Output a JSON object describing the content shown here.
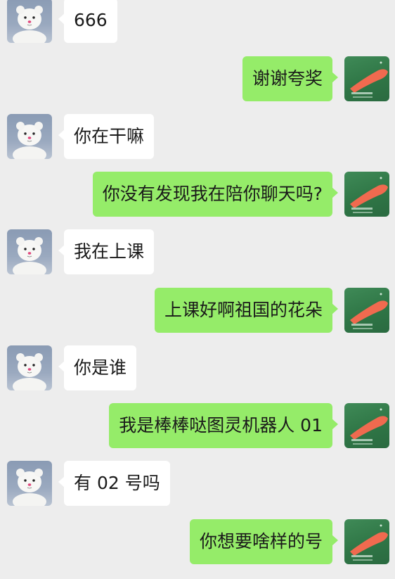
{
  "conversation": {
    "messages": [
      {
        "side": "left",
        "text": "666",
        "avatar": "bear-avatar"
      },
      {
        "side": "right",
        "text": "谢谢夸奖",
        "avatar": "green-cartoon-avatar"
      },
      {
        "side": "left",
        "text": "你在干嘛",
        "avatar": "bear-avatar"
      },
      {
        "side": "right",
        "text": "你没有发现我在陪你聊天吗?",
        "avatar": "green-cartoon-avatar"
      },
      {
        "side": "left",
        "text": "我在上课",
        "avatar": "bear-avatar"
      },
      {
        "side": "right",
        "text": "上课好啊祖国的花朵",
        "avatar": "green-cartoon-avatar"
      },
      {
        "side": "left",
        "text": "你是谁",
        "avatar": "bear-avatar"
      },
      {
        "side": "right",
        "text": "我是棒棒哒图灵机器人 01",
        "avatar": "green-cartoon-avatar"
      },
      {
        "side": "left",
        "text": "有 02 号吗",
        "avatar": "bear-avatar"
      },
      {
        "side": "right",
        "text": "你想要啥样的号",
        "avatar": "green-cartoon-avatar"
      }
    ],
    "colors": {
      "background": "#ededed",
      "incoming_bubble": "#ffffff",
      "outgoing_bubble": "#95ec69"
    }
  }
}
